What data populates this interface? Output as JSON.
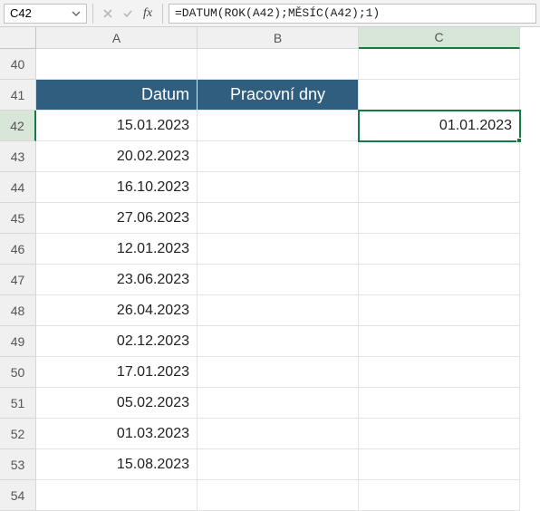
{
  "formulaBar": {
    "nameBox": "C42",
    "formula": "=DATUM(ROK(A42);MĚSÍC(A42);1)"
  },
  "columns": [
    "A",
    "B",
    "C"
  ],
  "activeColumn": "C",
  "activeRowNumber": "42",
  "rows": [
    {
      "num": "40",
      "a": "",
      "b": "",
      "c": ""
    },
    {
      "num": "41",
      "a": "Datum",
      "b": "Pracovní dny",
      "c": "",
      "header": true
    },
    {
      "num": "42",
      "a": "15.01.2023",
      "b": "",
      "c": "01.01.2023",
      "active": true
    },
    {
      "num": "43",
      "a": "20.02.2023",
      "b": "",
      "c": ""
    },
    {
      "num": "44",
      "a": "16.10.2023",
      "b": "",
      "c": ""
    },
    {
      "num": "45",
      "a": "27.06.2023",
      "b": "",
      "c": ""
    },
    {
      "num": "46",
      "a": "12.01.2023",
      "b": "",
      "c": ""
    },
    {
      "num": "47",
      "a": "23.06.2023",
      "b": "",
      "c": ""
    },
    {
      "num": "48",
      "a": "26.04.2023",
      "b": "",
      "c": ""
    },
    {
      "num": "49",
      "a": "02.12.2023",
      "b": "",
      "c": ""
    },
    {
      "num": "50",
      "a": "17.01.2023",
      "b": "",
      "c": ""
    },
    {
      "num": "51",
      "a": "05.02.2023",
      "b": "",
      "c": ""
    },
    {
      "num": "52",
      "a": "01.03.2023",
      "b": "",
      "c": ""
    },
    {
      "num": "53",
      "a": "15.08.2023",
      "b": "",
      "c": ""
    },
    {
      "num": "54",
      "a": "",
      "b": "",
      "c": ""
    }
  ],
  "icons": {
    "cancel": "✕",
    "confirm": "✓",
    "fx": "fx"
  }
}
